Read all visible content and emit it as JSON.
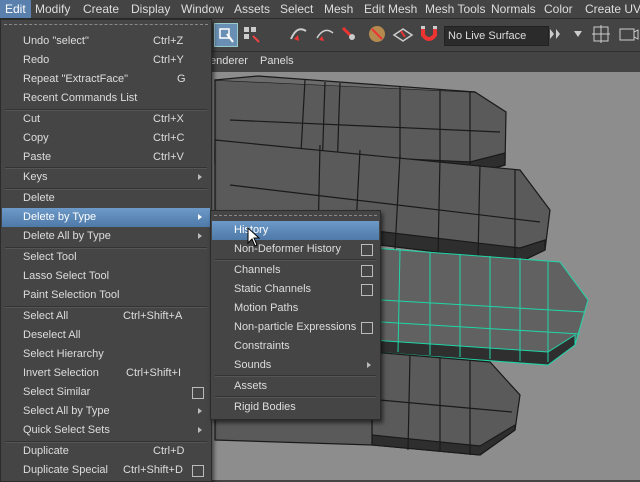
{
  "menubar": [
    "Edit",
    "Modify",
    "Create",
    "Display",
    "Window",
    "Assets",
    "Select",
    "Mesh",
    "Edit Mesh",
    "Mesh Tools",
    "Normals",
    "Color",
    "Create UVs"
  ],
  "toolbar": {
    "live_surface": "No Live Surface"
  },
  "panel_menu": [
    "enderer",
    "Panels"
  ],
  "edit_menu": {
    "undo": {
      "label": "Undo \"select\"",
      "shortcut": "Ctrl+Z"
    },
    "redo": {
      "label": "Redo",
      "shortcut": "Ctrl+Y"
    },
    "repeat": {
      "label": "Repeat \"ExtractFace\"",
      "shortcut": "G"
    },
    "recent": {
      "label": "Recent Commands List"
    },
    "cut": {
      "label": "Cut",
      "shortcut": "Ctrl+X"
    },
    "copy": {
      "label": "Copy",
      "shortcut": "Ctrl+C"
    },
    "paste": {
      "label": "Paste",
      "shortcut": "Ctrl+V"
    },
    "keys": {
      "label": "Keys"
    },
    "delete": {
      "label": "Delete"
    },
    "delete_by_type": {
      "label": "Delete by Type"
    },
    "delete_all_by_type": {
      "label": "Delete All by Type"
    },
    "select_tool": {
      "label": "Select Tool"
    },
    "lasso": {
      "label": "Lasso Select Tool"
    },
    "paint": {
      "label": "Paint Selection Tool"
    },
    "select_all": {
      "label": "Select All",
      "shortcut": "Ctrl+Shift+A"
    },
    "deselect_all": {
      "label": "Deselect All"
    },
    "select_hierarchy": {
      "label": "Select Hierarchy"
    },
    "invert": {
      "label": "Invert Selection",
      "shortcut": "Ctrl+Shift+I"
    },
    "select_similar": {
      "label": "Select Similar"
    },
    "select_all_by_type": {
      "label": "Select All by Type"
    },
    "quick_sets": {
      "label": "Quick Select Sets"
    },
    "duplicate": {
      "label": "Duplicate",
      "shortcut": "Ctrl+D"
    },
    "dup_special": {
      "label": "Duplicate Special",
      "shortcut": "Ctrl+Shift+D"
    }
  },
  "submenu": {
    "history": "History",
    "non_deformer": "Non-Deformer History",
    "channels": "Channels",
    "static_channels": "Static Channels",
    "motion_paths": "Motion Paths",
    "non_particle": "Non-particle Expressions",
    "constraints": "Constraints",
    "sounds": "Sounds",
    "assets": "Assets",
    "rigid_bodies": "Rigid Bodies"
  }
}
